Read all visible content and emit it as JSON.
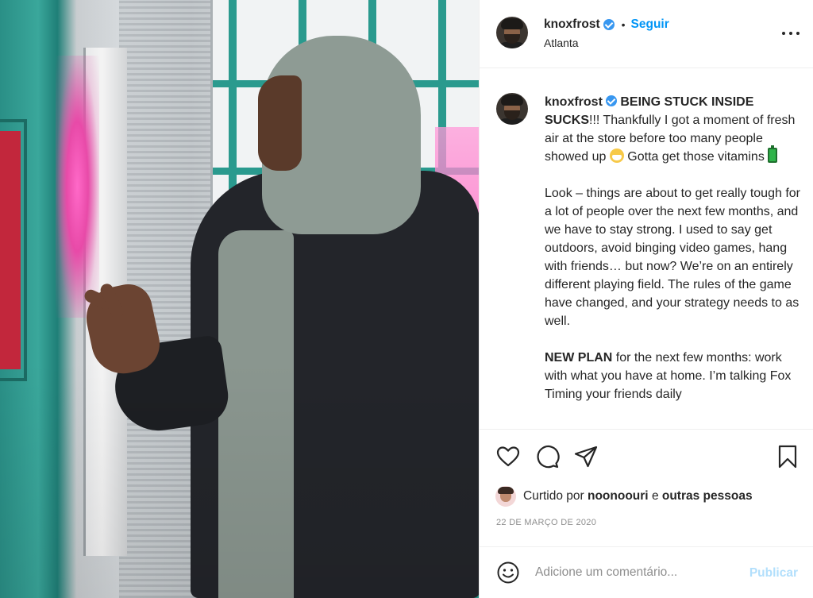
{
  "post": {
    "username": "knoxfrost",
    "follow_label": "Seguir",
    "separator": "•",
    "location": "Atlanta",
    "more_icon": "more-options-icon",
    "caption": {
      "username": "knoxfrost",
      "line1_bold": "BEING STUCK INSIDE SUCKS",
      "line1_rest": "!!! Thankfully I got a moment of fresh air at the store before too many people showed up",
      "line1_after_emoji": "Gotta get those vitamins",
      "paragraph2": "Look – things are about to get really tough for a lot of people over the next few months, and we have to stay strong. I used to say get outdoors, avoid binging video games, hang with friends… but now? We’re on an entirely different playing field. The rules of the game have changed, and your strategy needs to as well.",
      "paragraph3_bold": "NEW PLAN",
      "paragraph3_rest": "for the next few months: work with what you have at home. I’m talking Fox Timing your friends daily"
    },
    "actions": {
      "like_icon": "heart-icon",
      "comment_icon": "comment-icon",
      "share_icon": "send-icon",
      "save_icon": "bookmark-icon"
    },
    "likes": {
      "prefix": "Curtido por",
      "user": "noonoouri",
      "conj": "e",
      "others": "outras pessoas"
    },
    "date": "22 de março de 2020",
    "comment": {
      "placeholder": "Adicione um comentário...",
      "publish_label": "Publicar",
      "emoji_icon": "smile-icon"
    }
  },
  "colors": {
    "link_blue": "#0095f6",
    "publish_disabled": "#b2dffc",
    "muted": "#8e8e8e",
    "text": "#262626",
    "verified": "#3897f0"
  }
}
